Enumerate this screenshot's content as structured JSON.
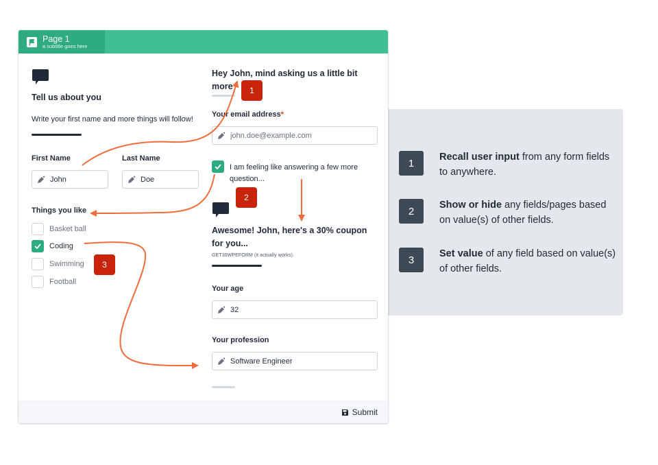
{
  "header": {
    "page_title": "Page 1",
    "page_subtitle": "a subtitle goes here"
  },
  "left_column": {
    "section_title": "Tell us about you",
    "section_description": "Write your first name and more things will follow!",
    "first_name": {
      "label": "First Name",
      "value": "John"
    },
    "last_name": {
      "label": "Last Name",
      "value": "Doe"
    },
    "things_you_like": {
      "label": "Things you like",
      "options": [
        {
          "label": "Basket ball",
          "checked": false
        },
        {
          "label": "Coding",
          "checked": true
        },
        {
          "label": "Swimming",
          "checked": false
        },
        {
          "label": "Football",
          "checked": false
        }
      ]
    }
  },
  "right_column": {
    "greeting": "Hey John, mind asking us a little bit more",
    "email": {
      "label": "Your email address",
      "required_mark": "*",
      "placeholder": "john.doe@example.com"
    },
    "more_questions": {
      "label": "I am feeling like answering a few more question...",
      "checked": true
    },
    "coupon_title": "Awesome! John, here's a 30% coupon for you...",
    "coupon_note": "GET30WPEFORM (it actually works).",
    "age": {
      "label": "Your age",
      "value": "32"
    },
    "profession": {
      "label": "Your profession",
      "value": "Software Engineer"
    }
  },
  "footer": {
    "submit_label": "Submit"
  },
  "annotations": {
    "badges": [
      "1",
      "2",
      "3"
    ],
    "arrow_color": "#f26b3a",
    "badge_color": "#c8240b"
  },
  "features": [
    {
      "number": "1",
      "bold": "Recall user input",
      "rest": " from any form fields to anywhere."
    },
    {
      "number": "2",
      "bold": "Show or hide",
      "rest": " any fields/pages based on value(s) of other fields."
    },
    {
      "number": "3",
      "bold": "Set value",
      "rest": " of any field based on value(s) of other fields."
    }
  ],
  "colors": {
    "header_green": "#3ebe91",
    "tab_green": "#2eab7f",
    "checkbox_green": "#2eab7f",
    "panel_bg": "#e4e7eb",
    "feature_badge": "#3d4955"
  }
}
